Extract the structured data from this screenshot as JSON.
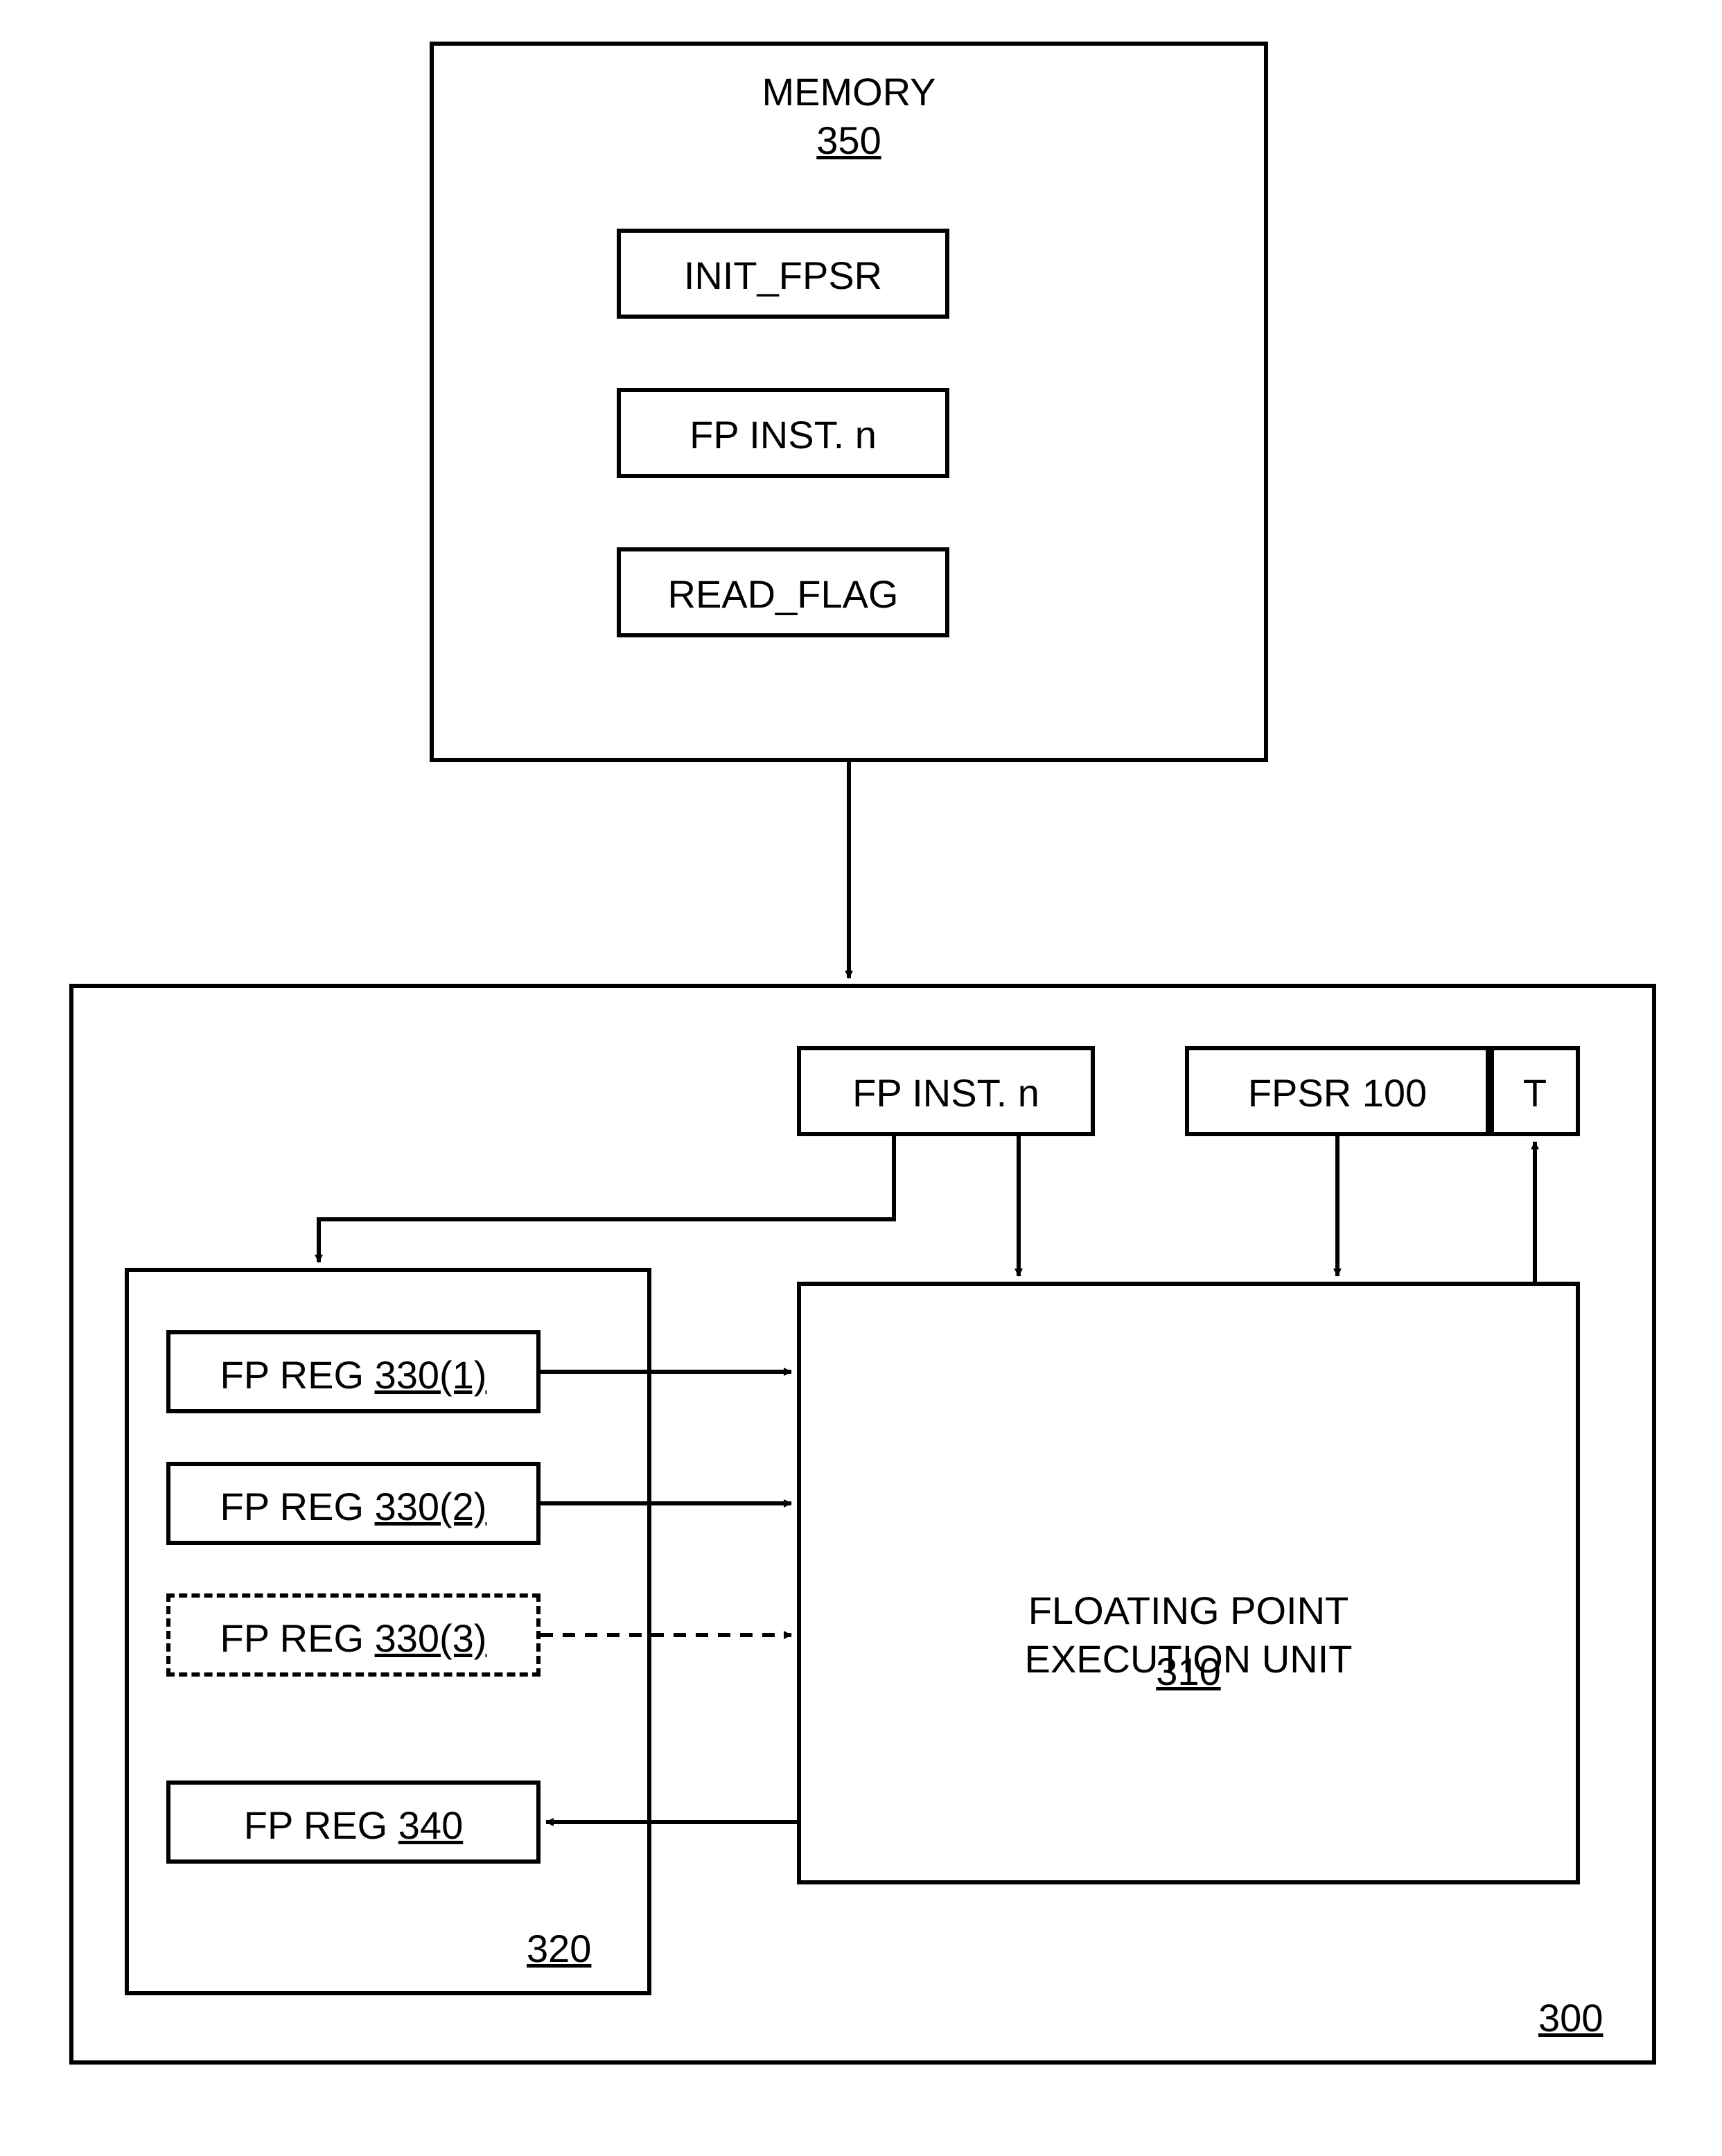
{
  "memory": {
    "title": "MEMORY",
    "ref": "350",
    "items": [
      "INIT_FPSR",
      "FP INST. n",
      "READ_FLAG"
    ]
  },
  "processor": {
    "ref": "300",
    "fp_inst": "FP INST. n",
    "fpsr": "FPSR 100",
    "t": "T",
    "regfile": {
      "ref": "320",
      "regs": [
        {
          "prefix": "FP REG ",
          "num": "330(1)"
        },
        {
          "prefix": "FP REG ",
          "num": "330(2)"
        },
        {
          "prefix": "FP REG ",
          "num": "330(3)"
        },
        {
          "prefix": "FP REG  ",
          "num": "340"
        }
      ]
    },
    "exec": {
      "title": "FLOATING POINT\nEXECUTION UNIT",
      "ref": "310"
    }
  }
}
